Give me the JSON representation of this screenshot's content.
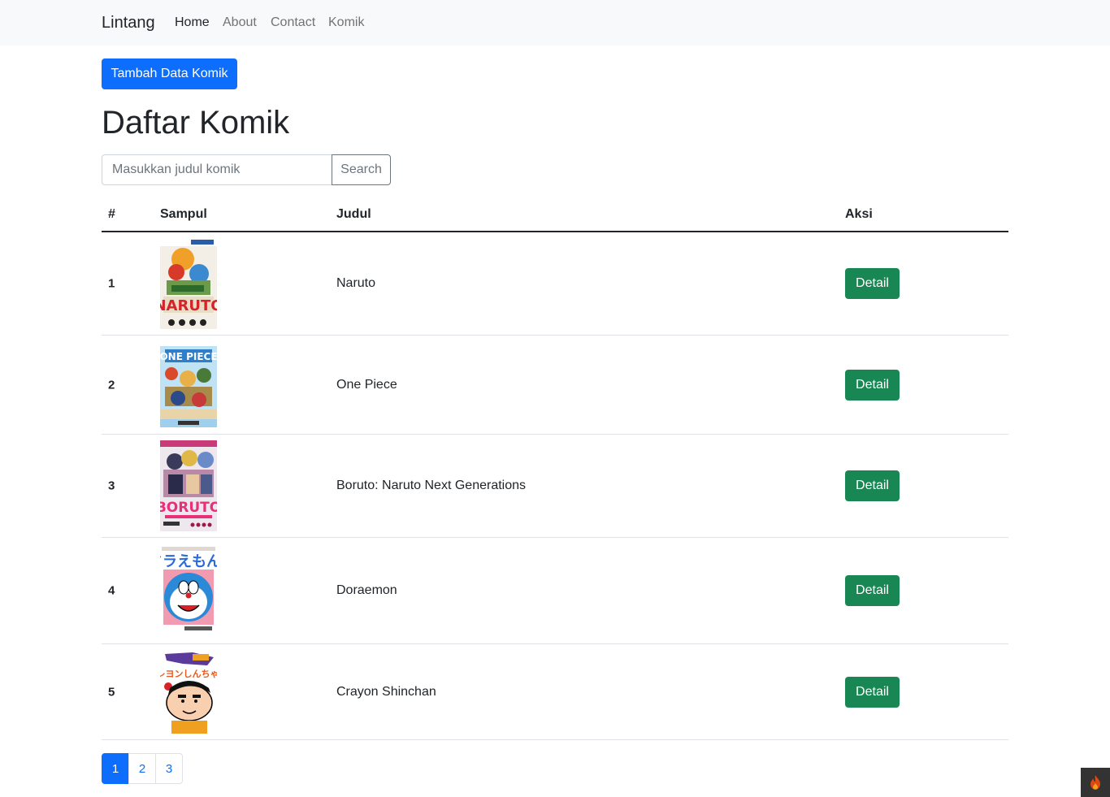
{
  "navbar": {
    "brand": "Lintang",
    "links": [
      {
        "label": "Home",
        "active": true
      },
      {
        "label": "About",
        "active": false
      },
      {
        "label": "Contact",
        "active": false
      },
      {
        "label": "Komik",
        "active": false
      }
    ]
  },
  "actions": {
    "add_label": "Tambah Data Komik"
  },
  "page": {
    "title": "Daftar Komik"
  },
  "search": {
    "placeholder": "Masukkan judul komik",
    "value": "",
    "button_label": "Search"
  },
  "table": {
    "headers": [
      "#",
      "Sampul",
      "Judul",
      "Aksi"
    ],
    "rows": [
      {
        "num": "1",
        "title": "Naruto",
        "action": "Detail",
        "cover_icon": "naruto-cover-image"
      },
      {
        "num": "2",
        "title": "One Piece",
        "action": "Detail",
        "cover_icon": "one-piece-cover-image"
      },
      {
        "num": "3",
        "title": "Boruto: Naruto Next Generations",
        "action": "Detail",
        "cover_icon": "boruto-cover-image"
      },
      {
        "num": "4",
        "title": "Doraemon",
        "action": "Detail",
        "cover_icon": "doraemon-cover-image"
      },
      {
        "num": "5",
        "title": "Crayon Shinchan",
        "action": "Detail",
        "cover_icon": "shinchan-cover-image"
      }
    ]
  },
  "pagination": {
    "pages": [
      "1",
      "2",
      "3"
    ],
    "current": "1"
  },
  "colors": {
    "primary": "#0d6efd",
    "success": "#198754",
    "navbar_bg": "#f8f9fa",
    "text": "#212529"
  },
  "debug_toolbar": {
    "icon": "flame-icon"
  }
}
